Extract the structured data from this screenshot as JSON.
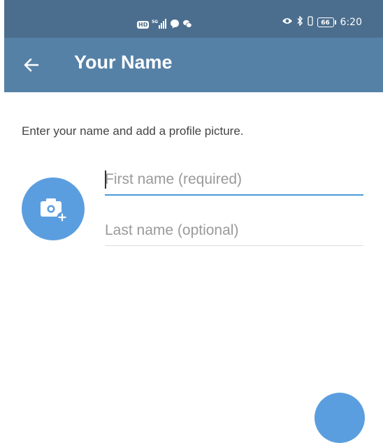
{
  "status_bar": {
    "hd_label": "HD",
    "network_label": "5G",
    "battery_level": "66",
    "time": "6:20"
  },
  "header": {
    "title": "Your Name",
    "back_icon": "arrow-left-icon"
  },
  "instruction": "Enter your name and add a profile picture.",
  "form": {
    "first_name": {
      "value": "",
      "placeholder": "First name (required)"
    },
    "last_name": {
      "value": "",
      "placeholder": "Last name (optional)"
    }
  },
  "avatar": {
    "icon": "add-photo-icon"
  },
  "colors": {
    "status_bar": "#4c6e8e",
    "app_bar": "#5681a7",
    "accent": "#5b9edf",
    "active_underline": "#4a9bd9"
  }
}
